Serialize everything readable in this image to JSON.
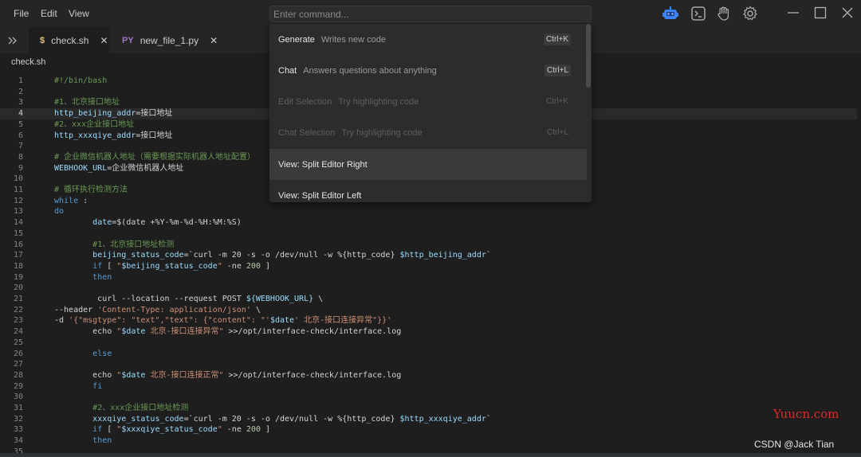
{
  "menu": {
    "file": "File",
    "edit": "Edit",
    "view": "View"
  },
  "command": {
    "placeholder": "Enter command..."
  },
  "titlebar_icons": [
    "robot-icon",
    "terminal-icon",
    "hand-icon",
    "gear-icon"
  ],
  "tabs": [
    {
      "badge": "$",
      "label": "check.sh",
      "active": true,
      "badge_color": "#e5c07b"
    },
    {
      "badge": "PY",
      "label": "new_file_1.py",
      "active": false,
      "badge_color": "#a074c4"
    }
  ],
  "breadcrumb": "check.sh",
  "palette": {
    "items": [
      {
        "title": "Generate",
        "desc": "Writes new code",
        "kbd": "Ctrl+K",
        "disabled": false
      },
      {
        "title": "Chat",
        "desc": "Answers questions about anything",
        "kbd": "Ctrl+L",
        "disabled": false
      },
      {
        "title": "Edit Selection",
        "desc": "Try highlighting code",
        "kbd": "Ctrl+K",
        "disabled": true
      },
      {
        "title": "Chat Selection",
        "desc": "Try highlighting code",
        "kbd": "Ctrl+L",
        "disabled": true
      },
      {
        "title": "View: Split Editor Right",
        "desc": "",
        "kbd": "",
        "disabled": false,
        "selected": true
      },
      {
        "title": "View: Split Editor Left",
        "desc": "",
        "kbd": "",
        "disabled": false
      }
    ]
  },
  "editor": {
    "current_line": 4,
    "lines": [
      [
        [
          "c-cm",
          "#!/bin/bash"
        ]
      ],
      [],
      [
        [
          "c-cm",
          "#1、北京接口地址"
        ]
      ],
      [
        [
          "c-var",
          "http_beijing_addr"
        ],
        [
          "c-op",
          "=接口地址"
        ]
      ],
      [
        [
          "c-cm",
          "#2、xxx企业接口地址"
        ]
      ],
      [
        [
          "c-var",
          "http_xxxqiye_addr"
        ],
        [
          "c-op",
          "=接口地址"
        ]
      ],
      [],
      [
        [
          "c-cm",
          "# 企业微信机器人地址（需要根据实际机器人地址配置）"
        ]
      ],
      [
        [
          "c-var",
          "WEBHOOK_URL"
        ],
        [
          "c-op",
          "=企业微信机器人地址"
        ]
      ],
      [],
      [
        [
          "c-cm",
          "# 循环执行检测方法"
        ]
      ],
      [
        [
          "c-kw",
          "while"
        ],
        [
          "c-plain",
          " :"
        ]
      ],
      [
        [
          "c-kw",
          "do"
        ]
      ],
      [
        [
          "c-plain",
          "        "
        ],
        [
          "c-var",
          "date"
        ],
        [
          "c-op",
          "=$(date +%Y-%m-%d-%H:%M:%S)"
        ]
      ],
      [],
      [
        [
          "c-plain",
          "        "
        ],
        [
          "c-cm",
          "#1、北京接口地址检测"
        ]
      ],
      [
        [
          "c-plain",
          "        "
        ],
        [
          "c-var",
          "beijing_status_code"
        ],
        [
          "c-op",
          "=`curl -m 20 -s -o /dev/null -w %{http_code} "
        ],
        [
          "c-var",
          "$http_beijing_addr"
        ],
        [
          "c-op",
          "`"
        ]
      ],
      [
        [
          "c-plain",
          "        "
        ],
        [
          "c-kw",
          "if"
        ],
        [
          "c-plain",
          " [ "
        ],
        [
          "c-str",
          "\""
        ],
        [
          "c-var",
          "$beijing_status_code"
        ],
        [
          "c-str",
          "\""
        ],
        [
          "c-plain",
          " -ne "
        ],
        [
          "c-num",
          "200"
        ],
        [
          "c-plain",
          " ]"
        ]
      ],
      [
        [
          "c-plain",
          "        "
        ],
        [
          "c-kw",
          "then"
        ]
      ],
      [],
      [
        [
          "c-plain",
          "         curl --location --request POST "
        ],
        [
          "c-var",
          "${WEBHOOK_URL}"
        ],
        [
          "c-plain",
          " \\"
        ]
      ],
      [
        [
          "c-plain",
          "--header "
        ],
        [
          "c-str",
          "'Content-Type: application/json'"
        ],
        [
          "c-plain",
          " \\"
        ]
      ],
      [
        [
          "c-plain",
          "-d "
        ],
        [
          "c-str",
          "'{\"msgtype\": \"text\",\"text\": {\"content\": \"'"
        ],
        [
          "c-var",
          "$date"
        ],
        [
          "c-str",
          "' 北京-接口连接异常\"}}'"
        ]
      ],
      [
        [
          "c-plain",
          "        echo "
        ],
        [
          "c-str",
          "\""
        ],
        [
          "c-var",
          "$date"
        ],
        [
          "c-str",
          " 北京-接口连接异常\""
        ],
        [
          "c-plain",
          " >>/opt/interface-check/interface.log"
        ]
      ],
      [],
      [
        [
          "c-plain",
          "        "
        ],
        [
          "c-kw",
          "else"
        ]
      ],
      [],
      [
        [
          "c-plain",
          "        echo "
        ],
        [
          "c-str",
          "\""
        ],
        [
          "c-var",
          "$date"
        ],
        [
          "c-str",
          " 北京-接口连接正常\""
        ],
        [
          "c-plain",
          " >>/opt/interface-check/interface.log"
        ]
      ],
      [
        [
          "c-plain",
          "        "
        ],
        [
          "c-kw",
          "fi"
        ]
      ],
      [],
      [
        [
          "c-plain",
          "        "
        ],
        [
          "c-cm",
          "#2、xxx企业接口地址检测"
        ]
      ],
      [
        [
          "c-plain",
          "        "
        ],
        [
          "c-var",
          "xxxqiye_status_code"
        ],
        [
          "c-op",
          "=`curl -m 20 -s -o /dev/null -w %{http_code} "
        ],
        [
          "c-var",
          "$http_xxxqiye_addr"
        ],
        [
          "c-op",
          "`"
        ]
      ],
      [
        [
          "c-plain",
          "        "
        ],
        [
          "c-kw",
          "if"
        ],
        [
          "c-plain",
          " [ "
        ],
        [
          "c-str",
          "\""
        ],
        [
          "c-var",
          "$xxxqiye_status_code"
        ],
        [
          "c-str",
          "\""
        ],
        [
          "c-plain",
          " -ne "
        ],
        [
          "c-num",
          "200"
        ],
        [
          "c-plain",
          " ]"
        ]
      ],
      [
        [
          "c-plain",
          "        "
        ],
        [
          "c-kw",
          "then"
        ]
      ],
      []
    ]
  },
  "watermark": {
    "site": "Yuucn.com",
    "author": "CSDN @Jack Tian"
  }
}
